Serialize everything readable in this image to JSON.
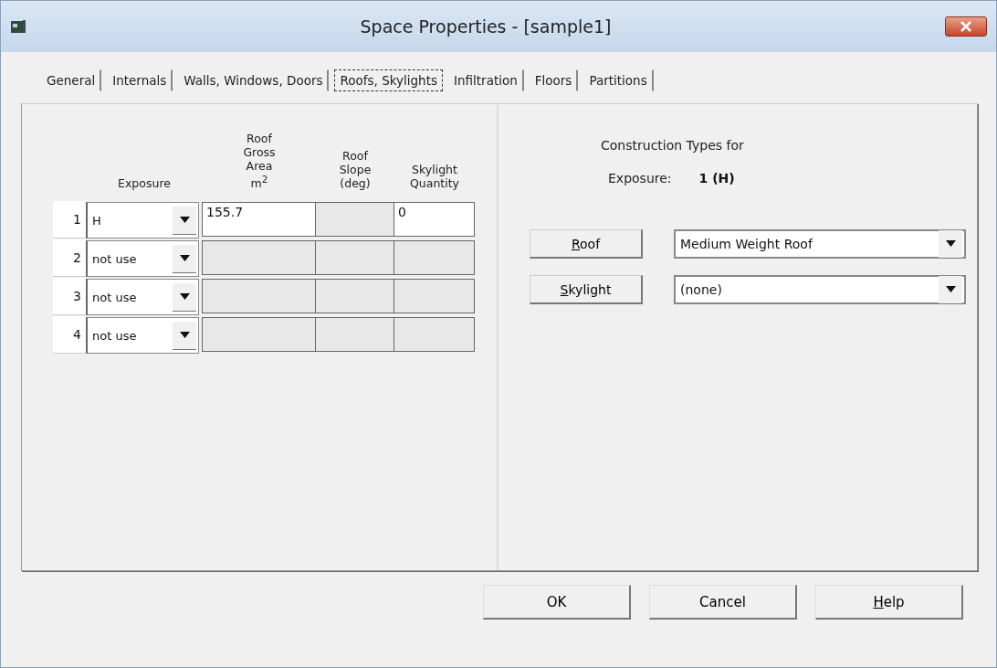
{
  "window": {
    "title": "Space Properties - [sample1]"
  },
  "tabs": [
    {
      "label": "General",
      "selected": false
    },
    {
      "label": "Internals",
      "selected": false
    },
    {
      "label": "Walls, Windows, Doors",
      "selected": false
    },
    {
      "label": "Roofs, Skylights",
      "selected": true
    },
    {
      "label": "Infiltration",
      "selected": false
    },
    {
      "label": "Floors",
      "selected": false
    },
    {
      "label": "Partitions",
      "selected": false
    }
  ],
  "table": {
    "columns": [
      [
        "Exposure"
      ],
      [
        "Roof",
        "Gross",
        "Area",
        "m$^{2}$"
      ],
      [
        "Roof",
        "Slope",
        "(deg)"
      ],
      [
        "Skylight",
        "Quantity"
      ]
    ],
    "rows": [
      {
        "number": "1",
        "exposure": "H",
        "area": "155.7",
        "quantity": "0",
        "active": true
      },
      {
        "number": "2",
        "exposure": "not use",
        "active": false
      },
      {
        "number": "3",
        "exposure": "not use",
        "active": false
      },
      {
        "number": "4",
        "exposure": "not use",
        "active": false
      }
    ]
  },
  "construction": {
    "heading": "Construction Types for",
    "exposure_label": "Exposure:",
    "exposure_value": "1 (H)",
    "items": [
      {
        "button": "Roof",
        "mnemonic": true,
        "value": "Medium Weight Roof"
      },
      {
        "button": "Skylight",
        "mnemonic": true,
        "value": "(none)"
      }
    ]
  },
  "buttons": [
    {
      "label": "OK",
      "mnemonic": false
    },
    {
      "label": "Cancel",
      "mnemonic": false
    },
    {
      "label": "Help",
      "mnemonic": true
    }
  ]
}
